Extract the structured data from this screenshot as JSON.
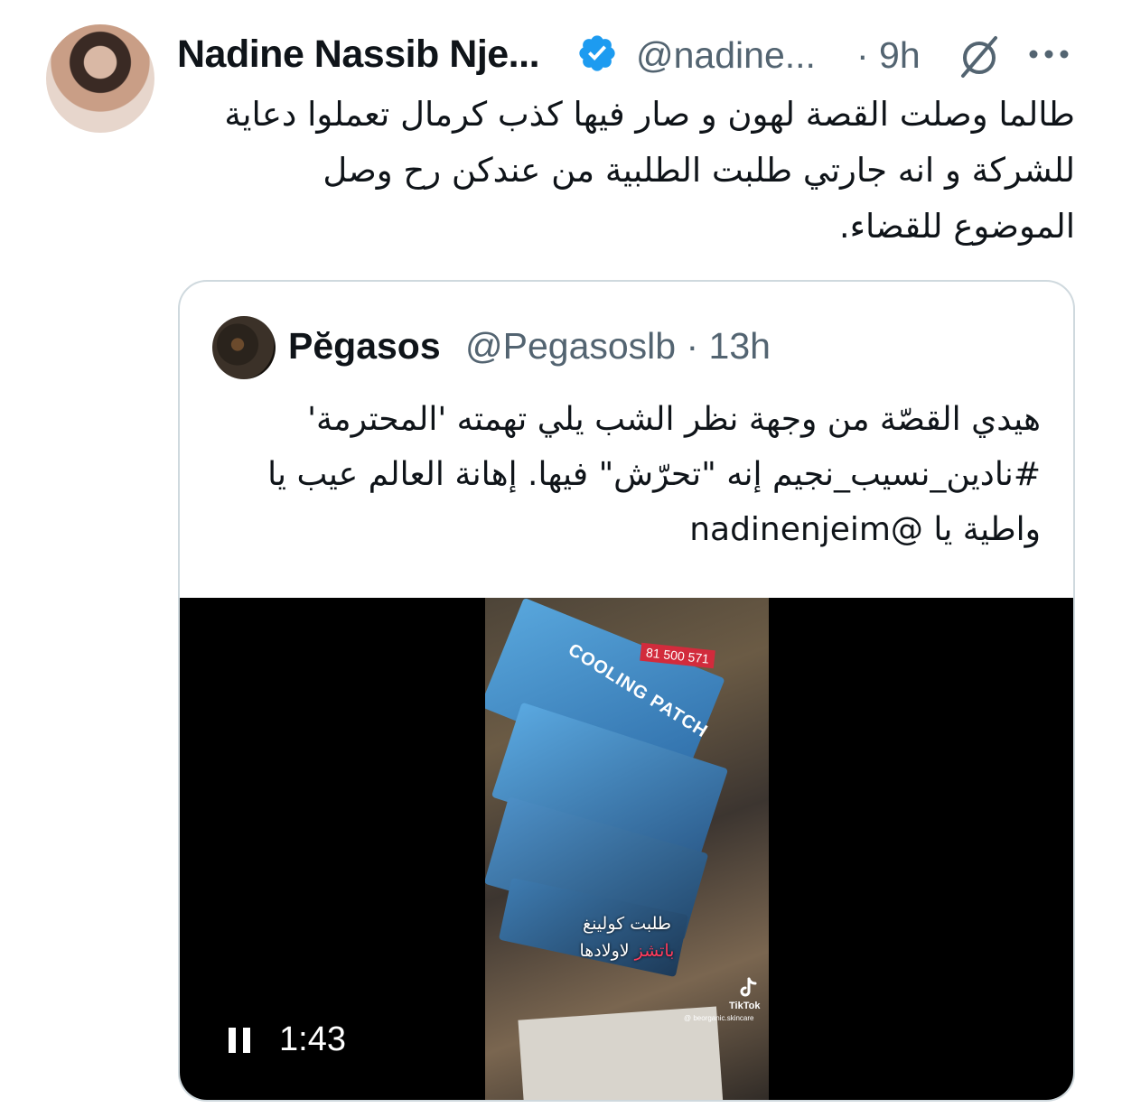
{
  "tweet": {
    "author_name": "Nadine Nassib Nje...",
    "author_handle": "@nadine...",
    "timestamp": "· 9h",
    "text": "طالما وصلت القصة لهون و صار فيها كذب كرمال تعملوا دعاية للشركة و انه جارتي طلبت الطلبية من عندكن رح وصل الموضوع للقضاء."
  },
  "quoted_tweet": {
    "author_name": "Pĕgasos",
    "author_handle_time": "@Pegasoslb · 13h",
    "text": "هيدي القصّة من وجهة نظر الشب يلي تهمته 'المحترمة' #نادين_نسيب_نجيم إنه \"تحرّش\" فيها. إهانة العالم عيب يا واطية يا @nadinenjeim"
  },
  "video": {
    "duration": "1:43",
    "overlay_phone": "81 500 571",
    "overlay_product": "COOLING PATCH",
    "caption_line1": "طلبت كولينغ",
    "caption_red": "باتشز",
    "caption_white": "لاولادها",
    "watermark_brand": "TikTok",
    "watermark_user": "@ beorganic.skincare"
  },
  "colors": {
    "text_primary": "#0f1419",
    "text_secondary": "#536471",
    "verified_blue": "#1d9bf0",
    "card_border": "#cfd9de"
  },
  "icons": [
    "verified-badge-icon",
    "grok-icon",
    "more-icon",
    "pause-icon",
    "tiktok-icon"
  ]
}
